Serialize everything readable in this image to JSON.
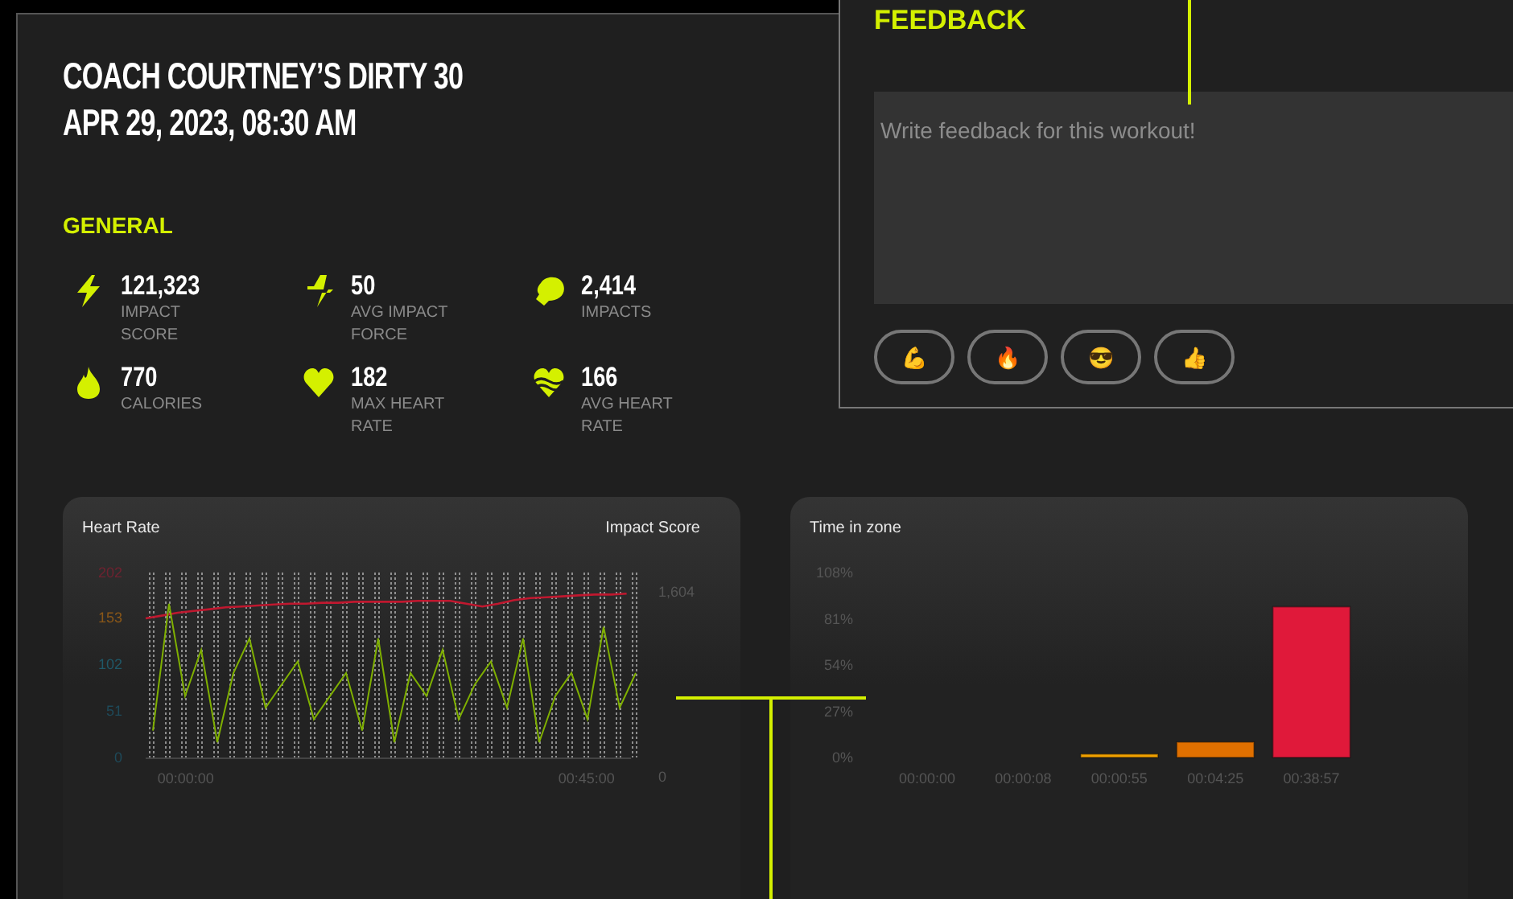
{
  "workout": {
    "title": "COACH COURTNEY’S DIRTY 30",
    "date": "APR 29, 2023, 08:30 AM"
  },
  "general": {
    "heading": "GENERAL",
    "stats": [
      {
        "kind": "impact-score",
        "value": "121,323",
        "label": "IMPACT SCORE"
      },
      {
        "kind": "avg-impact-force",
        "value": "50",
        "label": "AVG IMPACT FORCE"
      },
      {
        "kind": "impacts",
        "value": "2,414",
        "label": "IMPACTS"
      },
      {
        "kind": "calories",
        "value": "770",
        "label": "CALORIES"
      },
      {
        "kind": "max-heart-rate",
        "value": "182",
        "label": "MAX HEART RATE"
      },
      {
        "kind": "avg-heart-rate",
        "value": "166",
        "label": "AVG HEART RATE"
      }
    ]
  },
  "heart_rate_card": {
    "chart_data": {
      "type": "line",
      "x": [
        -4.5,
        -2.7,
        -0.9,
        0.9,
        2.7,
        4.5,
        6.3,
        8.1,
        9.9,
        11.7,
        13.5,
        15.3,
        17.1,
        18.9,
        20.7,
        22.5,
        24.3,
        26.1,
        27.9,
        29.7,
        31.5,
        33.3,
        35.1,
        36.9,
        38.7,
        40.5,
        42.3,
        44.1,
        45.9,
        47.7,
        49.5
      ],
      "series": [
        {
          "name": "Heart Rate",
          "color": "#c0182f",
          "values": [
            152,
            155,
            158,
            160,
            162,
            164,
            165,
            166,
            167,
            168,
            168,
            169,
            169,
            170,
            170,
            170,
            170,
            171,
            171,
            171,
            168,
            165,
            168,
            172,
            174,
            175,
            176,
            177,
            178,
            178,
            179
          ]
        }
      ],
      "xlim": [
        -4.5,
        50
      ],
      "xticks": [
        {
          "value": 0,
          "label": "00:00:00"
        },
        {
          "value": 45,
          "label": "00:45:00"
        }
      ],
      "ylim": [
        0,
        202
      ],
      "yticks": [
        {
          "value": 202,
          "label": "202"
        },
        {
          "value": 153,
          "label": "153"
        },
        {
          "value": 102,
          "label": "102"
        },
        {
          "value": 51,
          "label": "51"
        },
        {
          "value": 0,
          "label": "0"
        }
      ]
    },
    "impact": {
      "chart_data": {
        "type": "line",
        "series": [
          {
            "name": "Impact Score",
            "color": "#7fb000",
            "values": [
              400,
              1500,
              700,
              1100,
              300,
              900,
              1200,
              600,
              800,
              1000,
              500,
              700,
              900,
              400,
              1200,
              300,
              900,
              700,
              1100,
              500,
              800,
              1000,
              600,
              1200,
              300,
              700,
              900,
              500,
              1300,
              600,
              900
            ]
          }
        ],
        "ylim": [
          0,
          1604
        ],
        "yticks": [
          {
            "value": 1604,
            "label": "1,604"
          },
          {
            "value": 0,
            "label": "0"
          }
        ]
      }
    }
  },
  "zone_card": {
    "title": "Time in zone",
    "chart_data": {
      "type": "bar",
      "categories": [
        "00:00:00",
        "00:00:08",
        "00:00:55",
        "00:04:25",
        "00:38:57"
      ],
      "stacked": true,
      "series": [
        {
          "values": [
            0,
            null,
            null,
            null,
            null
          ]
        },
        {
          "values": [
            null,
            0,
            null,
            null,
            null
          ]
        },
        {
          "color": "#f0a000",
          "values": [
            null,
            null,
            2,
            null,
            null
          ]
        },
        {
          "color": "#e07000",
          "values": [
            null,
            null,
            null,
            9,
            null
          ]
        },
        {
          "color": "#e0193a",
          "values": [
            null,
            null,
            null,
            null,
            88
          ]
        }
      ],
      "ylim": [
        0,
        108
      ],
      "yticks": [
        {
          "value": 0,
          "label": "0%"
        },
        {
          "value": 27,
          "label": "27%"
        },
        {
          "value": 54,
          "label": "54%"
        },
        {
          "value": 81,
          "label": "81%"
        },
        {
          "value": 108,
          "label": "108%"
        }
      ]
    }
  },
  "feedback": {
    "heading": "FEEDBACK",
    "placeholder": "Write feedback for this workout!",
    "reactions": [
      "💪",
      "🔥",
      "😎",
      "👍"
    ]
  }
}
